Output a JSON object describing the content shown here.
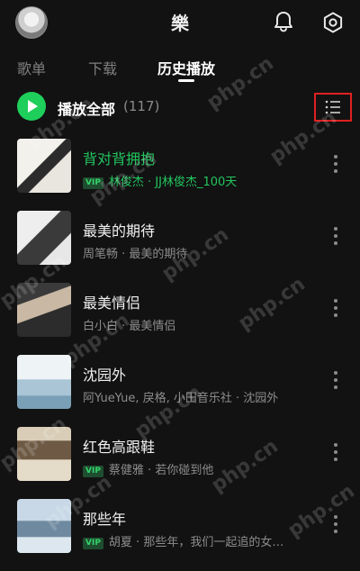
{
  "header": {
    "avatar": "user-avatar",
    "title": "樂",
    "bell_icon": "bell-icon",
    "settings_icon": "settings-icon"
  },
  "tabs": [
    {
      "label": "歌单",
      "active": false
    },
    {
      "label": "下载",
      "active": false
    },
    {
      "label": "历史播放",
      "active": true
    }
  ],
  "play_all": {
    "label": "播放全部",
    "count": "(117)",
    "icon": "play-icon",
    "list_mode_icon": "list-mode-icon"
  },
  "songs": [
    {
      "title": "背对背拥抱",
      "vip": "VIP",
      "meta": "林俊杰 · JJ林俊杰_100天",
      "playing": true
    },
    {
      "title": "最美的期待",
      "vip": "",
      "meta": "周笔畅 · 最美的期待",
      "playing": false
    },
    {
      "title": "最美情侣",
      "vip": "",
      "meta": "白小白 · 最美情侣",
      "playing": false
    },
    {
      "title": "沈园外",
      "vip": "",
      "meta": "阿YueYue, 戾格, 小田音乐社 · 沈园外",
      "playing": false
    },
    {
      "title": "红色高跟鞋",
      "vip": "VIP",
      "meta": "蔡健雅 · 若你碰到他",
      "playing": false
    },
    {
      "title": "那些年",
      "vip": "VIP",
      "meta": "胡夏 · 那些年，我们一起追的女…",
      "playing": false
    }
  ],
  "watermark": "php.cn",
  "colors": {
    "background": "#121212",
    "accent": "#22c55e",
    "highlight_box": "#e02020"
  }
}
